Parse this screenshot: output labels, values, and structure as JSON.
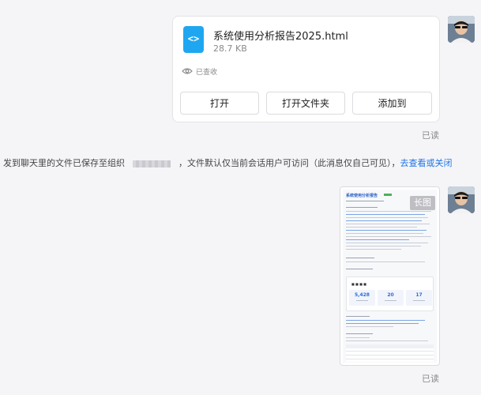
{
  "file_message": {
    "file_name": "系统使用分析报告2025.html",
    "file_size": "28.7 KB",
    "file_icon": "html-code-file-icon",
    "received_status": "已查收",
    "buttons": {
      "open": "打开",
      "open_folder": "打开文件夹",
      "add_to": "添加到"
    },
    "read_status": "已读"
  },
  "system_notice": {
    "text_before_org": "发到聊天里的文件已保存至组织",
    "text_after_org": "，文件默认仅当前会话用户可访问（此消息仅自己可见），",
    "link_text": "去查看或关闭"
  },
  "image_message": {
    "badge": "长图",
    "read_status": "已读",
    "preview": {
      "title": "系统使用分析报告",
      "stats": [
        "5,428",
        "20",
        "17"
      ]
    }
  },
  "colors": {
    "link": "#1d74e8",
    "file_icon": "#1ea7f0",
    "background": "#f5f5f7"
  }
}
